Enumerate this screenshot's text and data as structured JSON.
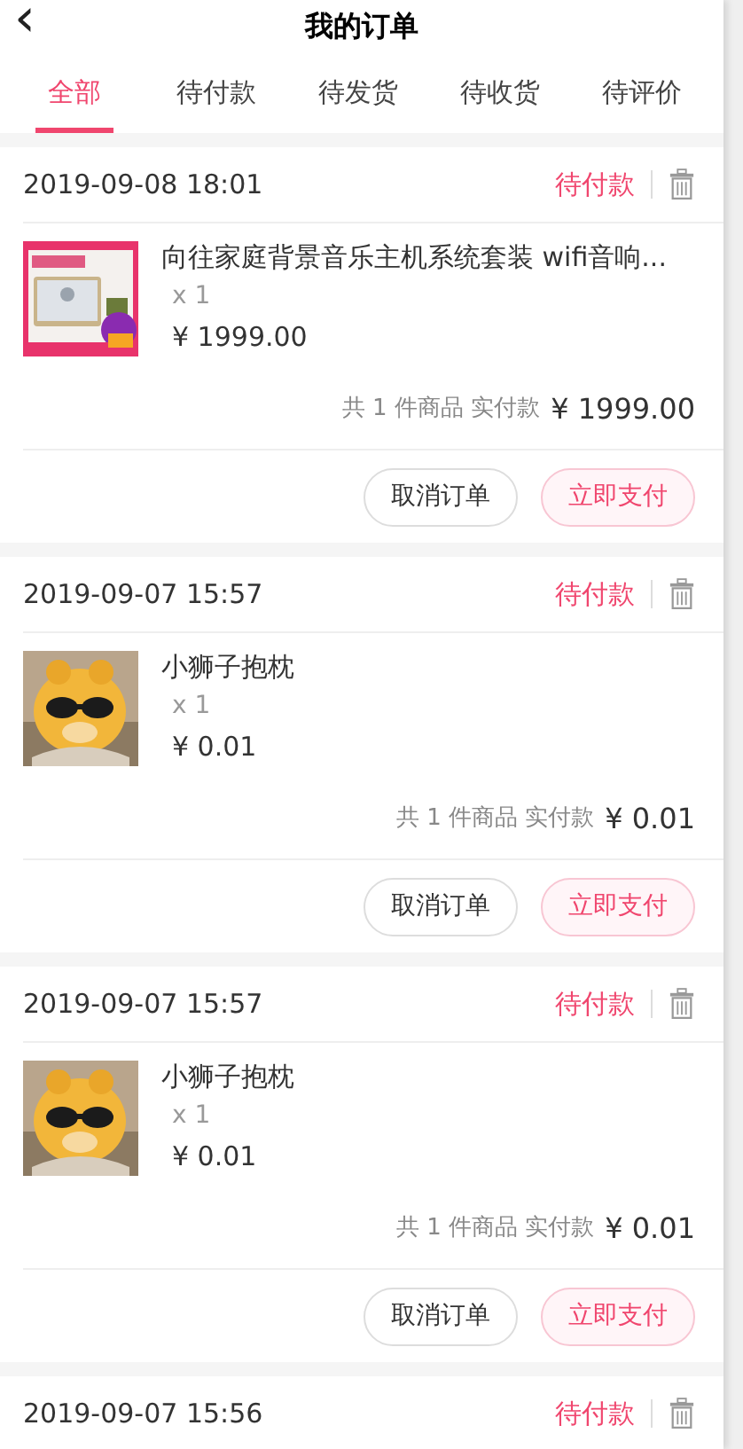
{
  "header": {
    "back": "‹",
    "title": "我的订单"
  },
  "tabs": [
    {
      "label": "全部",
      "selected": true
    },
    {
      "label": "待付款",
      "selected": false
    },
    {
      "label": "待发货",
      "selected": false
    },
    {
      "label": "待收货",
      "selected": false
    },
    {
      "label": "待评价",
      "selected": false
    }
  ],
  "orders": [
    {
      "time": "2019-09-08 18:01",
      "status": "待付款",
      "item": {
        "name": "向往家庭背景音乐主机系统套装 wifi音响...",
        "quantity": "x 1",
        "price": "¥ 1999.00"
      },
      "summary": "共 1 件商品 实付款",
      "total": "¥ 1999.00",
      "buttons": [
        {
          "label": "取消订单",
          "kind": "plain"
        },
        {
          "label": "立即支付",
          "kind": "primary"
        }
      ]
    },
    {
      "time": "2019-09-07 15:57",
      "status": "待付款",
      "item": {
        "name": "小狮子抱枕",
        "quantity": "x 1",
        "price": "¥ 0.01"
      },
      "summary": "共 1 件商品 实付款",
      "total": "¥ 0.01",
      "buttons": [
        {
          "label": "取消订单",
          "kind": "plain"
        },
        {
          "label": "立即支付",
          "kind": "primary"
        }
      ]
    },
    {
      "time": "2019-09-07 15:57",
      "status": "待付款",
      "item": {
        "name": "小狮子抱枕",
        "quantity": "x 1",
        "price": "¥ 0.01"
      },
      "summary": "共 1 件商品 实付款",
      "total": "¥ 0.01",
      "buttons": [
        {
          "label": "取消订单",
          "kind": "plain"
        },
        {
          "label": "立即支付",
          "kind": "primary"
        }
      ]
    },
    {
      "time": "2019-09-07 15:56",
      "status": "待付款"
    }
  ]
}
